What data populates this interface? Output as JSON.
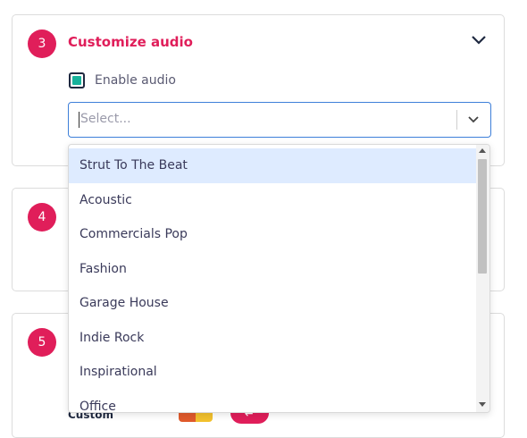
{
  "section3": {
    "step": "3",
    "title": "Customize audio",
    "enable_audio_label": "Enable audio",
    "enable_audio_checked": true,
    "select_placeholder": "Select...",
    "accent_color": "#e01e5a",
    "check_color": "#17b29b"
  },
  "section4": {
    "step": "4"
  },
  "section5": {
    "step": "5",
    "custom_label": "Custom"
  },
  "dropdown": {
    "selected_index": 0,
    "options": [
      "Strut To The Beat",
      "Acoustic",
      "Commercials Pop",
      "Fashion",
      "Garage House",
      "Indie Rock",
      "Inspirational",
      "Office"
    ]
  },
  "icons": {
    "collapse": "chevron-down-icon",
    "dropdown": "chevron-down-icon",
    "swap": "swap-arrow-icon"
  }
}
